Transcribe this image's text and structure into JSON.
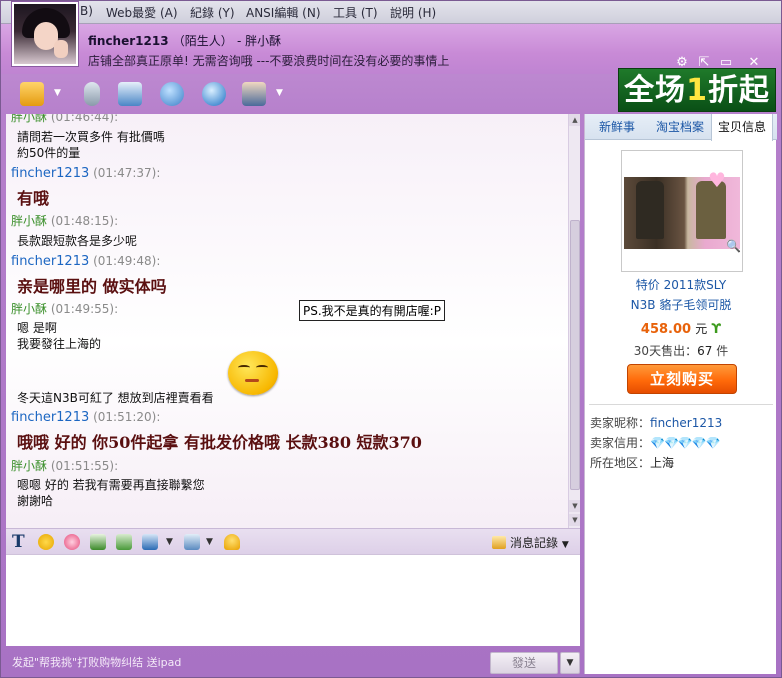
{
  "menu": {
    "items": [
      "B)",
      "Web最愛 (A)",
      "紀錄 (Y)",
      "ANSI編輯 (N)",
      "工具 (T)",
      "說明 (H)"
    ]
  },
  "title": {
    "name": "fincher1213",
    "status": "（陌生人）",
    "sep": " - ",
    "peer": "胖小酥",
    "signature": "店铺全部真正原单! 无需咨询哦 ---不要浪费时间在没有必要的事情上"
  },
  "window_buttons": [
    "⚙",
    "⇱",
    "▭",
    "✕"
  ],
  "ad": {
    "pre": "全场",
    "hl": "1",
    "post": "折起"
  },
  "chat": {
    "messages": [
      {
        "kind": "buyer",
        "sender": "胖小酥",
        "time": "(01:46:44):",
        "lines": [
          "請問若一次買多件 有批價嗎",
          "約50件的量"
        ]
      },
      {
        "kind": "self",
        "sender": "fincher1213",
        "time": "(01:47:37):",
        "big": "有哦"
      },
      {
        "kind": "buyer",
        "sender": "胖小酥",
        "time": "(01:48:15):",
        "lines": [
          "長款跟短款各是多少呢"
        ]
      },
      {
        "kind": "self",
        "sender": "fincher1213",
        "time": "(01:49:48):",
        "big": "亲是哪里的  做实体吗"
      },
      {
        "kind": "buyer",
        "sender": "胖小酥",
        "time": "(01:49:55):",
        "lines": [
          "嗯 是啊",
          "我要發往上海的",
          "冬天這N3B可紅了 想放到店裡賣看看"
        ]
      },
      {
        "kind": "self",
        "sender": "fincher1213",
        "time": "(01:51:20):",
        "big": "哦哦  好的  你50件起拿  有批发价格哦  长款380  短款370"
      },
      {
        "kind": "buyer",
        "sender": "胖小酥",
        "time": "(01:51:55):",
        "lines": [
          "嗯嗯 好的 若我有需要再直接聯繫您",
          "謝謝哈"
        ]
      }
    ],
    "tooltip": "PS.我不是真的有開店喔:P"
  },
  "edit_toolbar": {
    "history_label": "消息記錄"
  },
  "bottom": {
    "hint": "发起\"帮我挑\"打败购物纠结 送ipad",
    "send_label": "發送"
  },
  "right": {
    "tabs": [
      "新鲜事",
      "淘宝档案",
      "宝贝信息"
    ],
    "product": {
      "title_line1": "特价 2011款SLY",
      "title_line2": "N3B 貉子毛领可脱",
      "price": "458.00",
      "unit": "元",
      "sold_label": "30天售出：",
      "sold_count": "67",
      "sold_unit": "件",
      "buy_label": "立刻购买"
    },
    "seller": {
      "nick_label": "卖家昵称：",
      "nick": "fincher1213",
      "credit_label": "卖家信用：",
      "credit": "💎💎💎💎💎",
      "location_label": "所在地区：",
      "location": "上海"
    }
  },
  "colors": {
    "accent": "#1c57a6",
    "buy": "#ff6a0a",
    "self_name": "#1c66c2",
    "buyer_name": "#3a8f2a"
  }
}
